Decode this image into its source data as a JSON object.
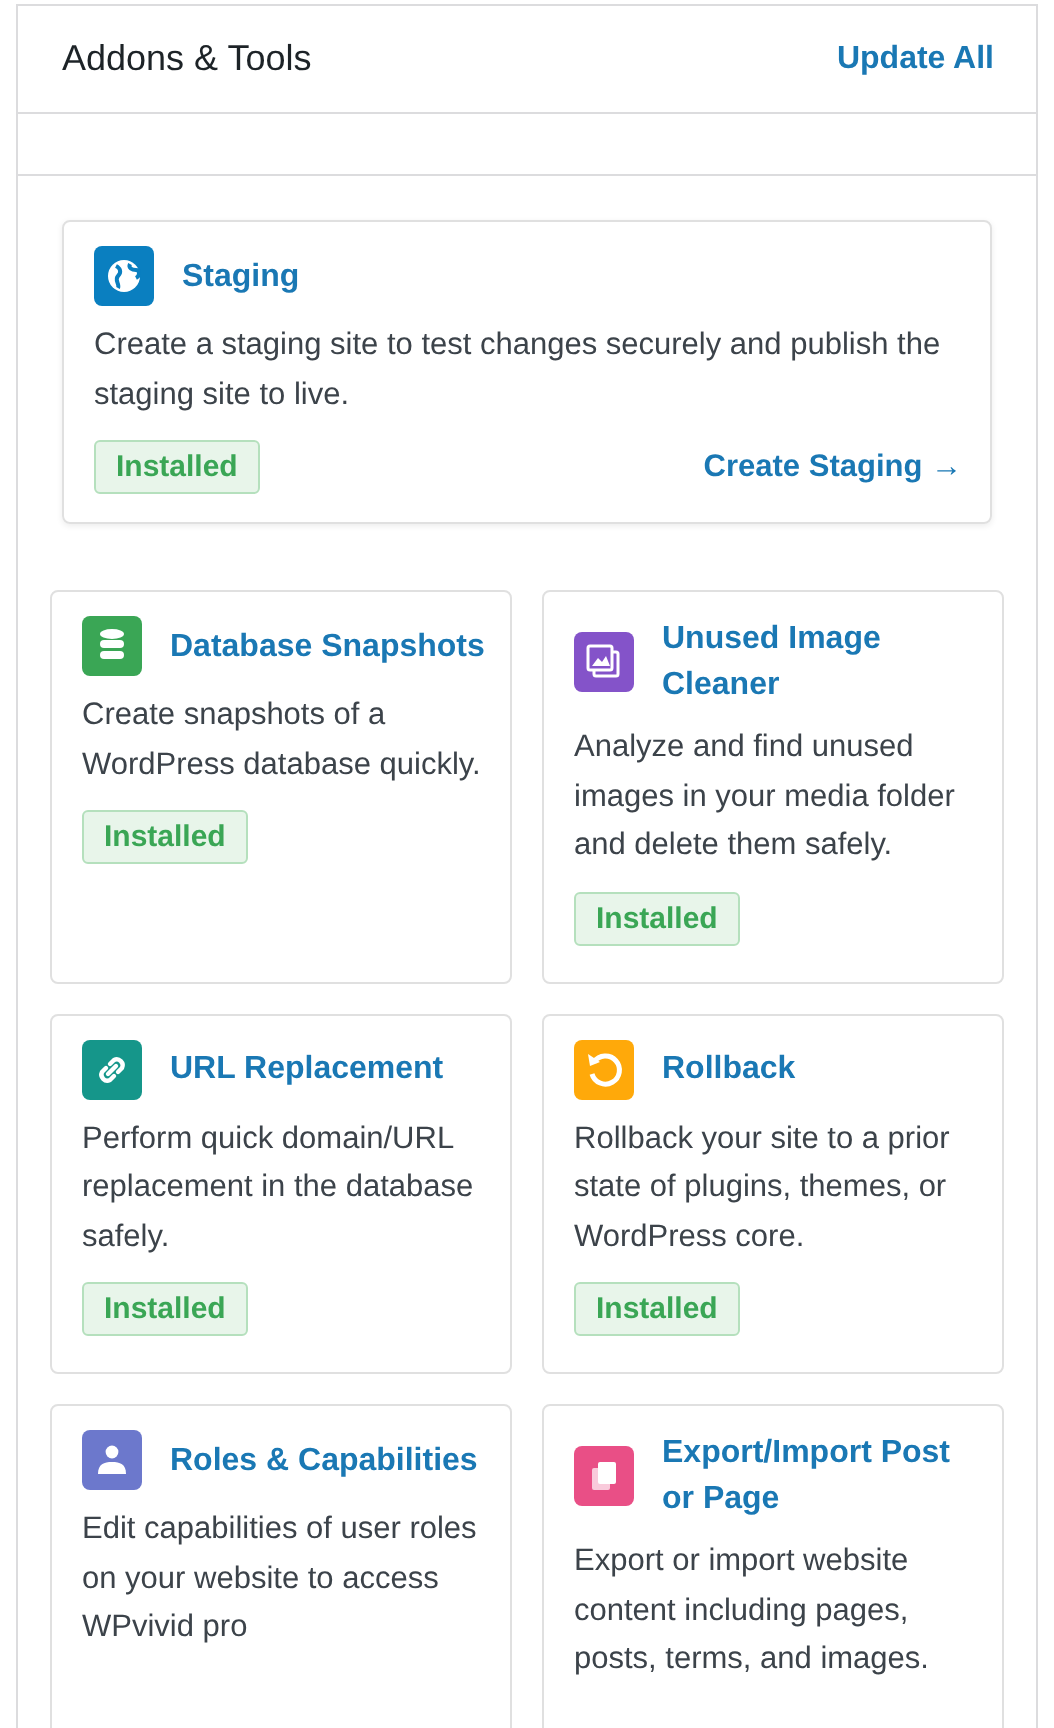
{
  "header": {
    "title": "Addons & Tools",
    "action": "Update All"
  },
  "featured": {
    "kind": "globe",
    "color": "#0a7fc0",
    "title": "Staging",
    "description": "Create a staging site to test changes securely and publish the staging site to live.",
    "badge": "Installed",
    "link": "Create Staging →"
  },
  "tools": [
    {
      "kind": "database",
      "color": "#3aa655",
      "title": "Database Snapshots",
      "description": "Create snapshots of a WordPress database quickly.",
      "badge": "Installed"
    },
    {
      "kind": "images",
      "color": "#8453c9",
      "title": "Unused Image Cleaner",
      "description": "Analyze and find unused images in your media folder and delete them safely.",
      "badge": "Installed"
    },
    {
      "kind": "link",
      "color": "#15968a",
      "title": "URL Replacement",
      "description": "Perform quick domain/URL replacement in the database safely.",
      "badge": "Installed"
    },
    {
      "kind": "rollback",
      "color": "#ffa90a",
      "title": "Rollback",
      "description": "Rollback your site to a prior state of plugins, themes, or WordPress core.",
      "badge": "Installed"
    },
    {
      "kind": "user",
      "color": "#6c78cc",
      "title": "Roles & Capabilities",
      "description": "Edit capabilities of user roles on your website to access WPvivid pro"
    },
    {
      "kind": "copy",
      "color": "#e94f86",
      "title": "Export/Import Post or Page",
      "description": "Export or import website content including pages, posts, terms, and images."
    }
  ]
}
